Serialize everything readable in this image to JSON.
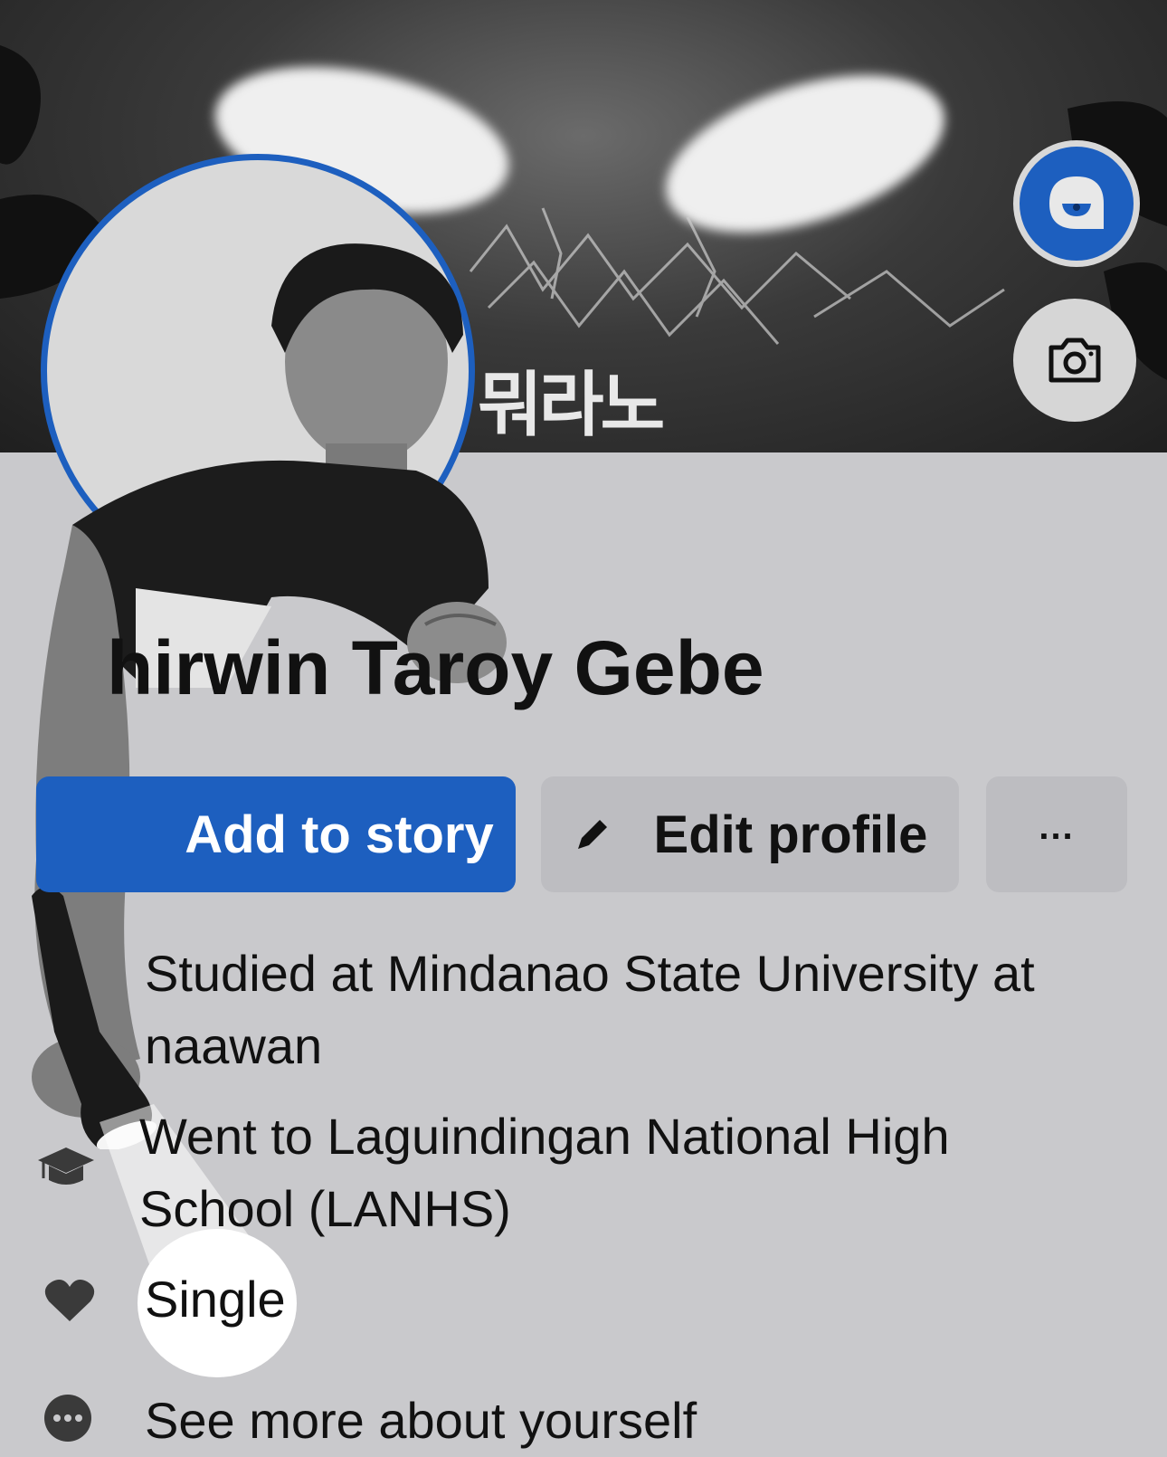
{
  "profile": {
    "name": "hirwin Taroy Gebe",
    "cover_title": "뭐라노"
  },
  "buttons": {
    "add_story": "Add to story",
    "edit_profile": "Edit profile",
    "more": "..."
  },
  "info": {
    "studied": "Studied at Mindanao State University at naawan",
    "went": "Went to Laguindingan National High School (LANHS)",
    "relationship": "Single",
    "see_more": "See more about yourself"
  },
  "icons": {
    "app": "app-face-icon",
    "camera": "camera-icon",
    "edit": "pencil-icon",
    "education": "graduation-cap-icon",
    "relationship": "heart-icon",
    "more": "more-dots-icon"
  },
  "colors": {
    "accent": "#1d5fbf",
    "background": "#c9c9cc",
    "secondary_button": "#bdbdc1"
  }
}
